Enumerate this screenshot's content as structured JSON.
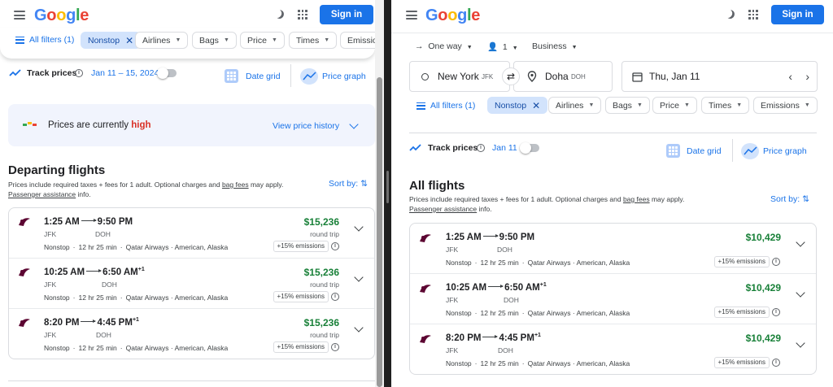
{
  "header": {
    "logo_letters": [
      "G",
      "o",
      "o",
      "g",
      "l",
      "e"
    ],
    "signin_label": "Sign in"
  },
  "left": {
    "filters": {
      "all_filters": "All filters (1)",
      "nonstop": "Nonstop",
      "airlines": "Airlines",
      "bags": "Bags",
      "price": "Price",
      "times": "Times",
      "emissions": "Emissions"
    },
    "track": {
      "label": "Track prices",
      "dates": "Jan 11 – 15, 2024",
      "date_grid": "Date grid",
      "price_graph": "Price graph"
    },
    "insight": {
      "prefix": "Prices are currently ",
      "level": "high",
      "history": "View price history"
    },
    "section_title": "Departing flights",
    "note": {
      "part1": "Prices include required taxes + fees for 1 adult. Optional charges and ",
      "bag_fees": "bag fees",
      "part2": " may apply.",
      "assist": "Passenger assistance",
      "part3": " info."
    },
    "sort_label": "Sort by:",
    "flights": [
      {
        "dep": "1:25 AM",
        "arr": "9:50 PM",
        "plus": "",
        "from": "JFK",
        "to": "DOH",
        "stops": "Nonstop",
        "duration": "12 hr 25 min",
        "airlines": "Qatar Airways · American, Alaska",
        "price": "$15,236",
        "trip": "round trip",
        "emissions": "+15% emissions"
      },
      {
        "dep": "10:25 AM",
        "arr": "6:50 AM",
        "plus": "+1",
        "from": "JFK",
        "to": "DOH",
        "stops": "Nonstop",
        "duration": "12 hr 25 min",
        "airlines": "Qatar Airways · American, Alaska",
        "price": "$15,236",
        "trip": "round trip",
        "emissions": "+15% emissions"
      },
      {
        "dep": "8:20 PM",
        "arr": "4:45 PM",
        "plus": "+1",
        "from": "JFK",
        "to": "DOH",
        "stops": "Nonstop",
        "duration": "12 hr 25 min",
        "airlines": "Qatar Airways · American, Alaska",
        "price": "$15,236",
        "trip": "round trip",
        "emissions": "+15% emissions"
      }
    ]
  },
  "right": {
    "trip_type": "One way",
    "passengers": "1",
    "cabin": "Business",
    "origin": "New York",
    "origin_code": "JFK",
    "destination": "Doha",
    "destination_code": "DOH",
    "date": "Thu, Jan 11",
    "filters": {
      "all_filters": "All filters (1)",
      "nonstop": "Nonstop",
      "airlines": "Airlines",
      "bags": "Bags",
      "price": "Price",
      "times": "Times",
      "emissions": "Emissions"
    },
    "track": {
      "label": "Track prices",
      "dates": "Jan 11",
      "date_grid": "Date grid",
      "price_graph": "Price graph"
    },
    "section_title": "All flights",
    "note": {
      "part1": "Prices include required taxes + fees for 1 adult. Optional charges and ",
      "bag_fees": "bag fees",
      "part2": " may apply.",
      "assist": "Passenger assistance",
      "part3": " info."
    },
    "sort_label": "Sort by:",
    "flights": [
      {
        "dep": "1:25 AM",
        "arr": "9:50 PM",
        "plus": "",
        "from": "JFK",
        "to": "DOH",
        "stops": "Nonstop",
        "duration": "12 hr 25 min",
        "airlines": "Qatar Airways · American, Alaska",
        "price": "$10,429",
        "emissions": "+15% emissions"
      },
      {
        "dep": "10:25 AM",
        "arr": "6:50 AM",
        "plus": "+1",
        "from": "JFK",
        "to": "DOH",
        "stops": "Nonstop",
        "duration": "12 hr 25 min",
        "airlines": "Qatar Airways · American, Alaska",
        "price": "$10,429",
        "emissions": "+15% emissions"
      },
      {
        "dep": "8:20 PM",
        "arr": "4:45 PM",
        "plus": "+1",
        "from": "JFK",
        "to": "DOH",
        "stops": "Nonstop",
        "duration": "12 hr 25 min",
        "airlines": "Qatar Airways · American, Alaska",
        "price": "$10,429",
        "emissions": "+15% emissions"
      }
    ]
  },
  "colors": {
    "accent": "#1a73e8",
    "price_green": "#188038",
    "high_red": "#d93025"
  }
}
